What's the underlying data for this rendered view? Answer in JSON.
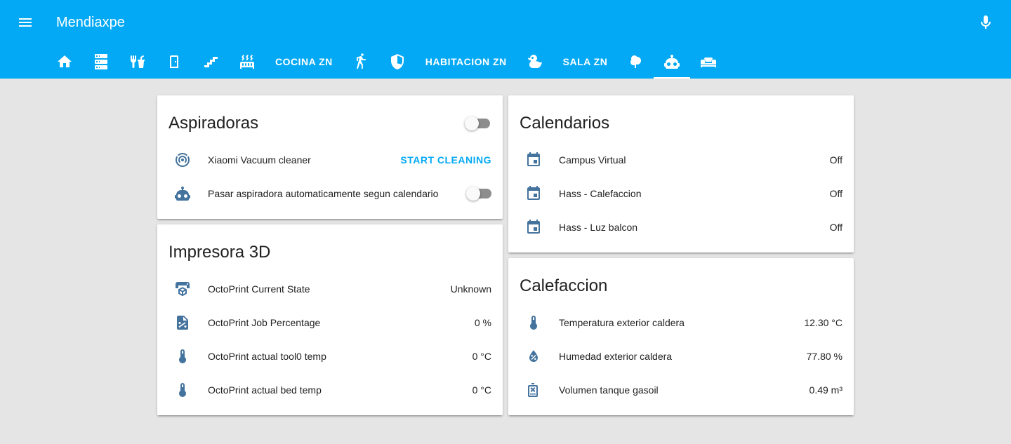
{
  "header": {
    "title": "Mendiaxpe",
    "tabs": [
      {
        "type": "icon",
        "icon": "home-icon"
      },
      {
        "type": "icon",
        "icon": "server-icon"
      },
      {
        "type": "icon",
        "icon": "silverware-icon"
      },
      {
        "type": "icon",
        "icon": "door-icon"
      },
      {
        "type": "icon",
        "icon": "stairs-icon"
      },
      {
        "type": "icon",
        "icon": "radiator-icon"
      },
      {
        "type": "text",
        "label": "COCINA ZN"
      },
      {
        "type": "icon",
        "icon": "walk-icon"
      },
      {
        "type": "icon",
        "icon": "shield-icon"
      },
      {
        "type": "text",
        "label": "HABITACION ZN"
      },
      {
        "type": "icon",
        "icon": "duck-icon"
      },
      {
        "type": "text",
        "label": "SALA ZN"
      },
      {
        "type": "icon",
        "icon": "tree-icon"
      },
      {
        "type": "icon",
        "icon": "robot-icon",
        "active": true
      },
      {
        "type": "icon",
        "icon": "sofa-icon"
      }
    ]
  },
  "aspiradoras": {
    "title": "Aspiradoras",
    "header_toggle": "off",
    "vacuum_label": "Xiaomi Vacuum cleaner",
    "vacuum_action": "START CLEANING",
    "auto_label": "Pasar aspiradora automaticamente segun calendario",
    "auto_toggle": "off"
  },
  "impresora": {
    "title": "Impresora 3D",
    "rows": [
      {
        "label": "OctoPrint Current State",
        "value": "Unknown",
        "icon": "printer-3d-icon"
      },
      {
        "label": "OctoPrint Job Percentage",
        "value": "0 %",
        "icon": "file-percent-icon"
      },
      {
        "label": "OctoPrint actual tool0 temp",
        "value": "0 °C",
        "icon": "thermometer-icon"
      },
      {
        "label": "OctoPrint actual bed temp",
        "value": "0 °C",
        "icon": "thermometer-icon"
      }
    ]
  },
  "calendarios": {
    "title": "Calendarios",
    "rows": [
      {
        "label": "Campus Virtual",
        "value": "Off",
        "icon": "calendar-icon"
      },
      {
        "label": "Hass - Calefaccion",
        "value": "Off",
        "icon": "calendar-icon"
      },
      {
        "label": "Hass - Luz balcon",
        "value": "Off",
        "icon": "calendar-icon"
      }
    ]
  },
  "calefaccion": {
    "title": "Calefaccion",
    "rows": [
      {
        "label": "Temperatura exterior caldera",
        "value": "12.30 °C",
        "icon": "thermometer-icon"
      },
      {
        "label": "Humedad exterior caldera",
        "value": "77.80 %",
        "icon": "water-percent-icon"
      },
      {
        "label": "Volumen tanque gasoil",
        "value": "0.49 m³",
        "icon": "gas-tank-icon"
      }
    ]
  },
  "colors": {
    "header": "#03a9f4",
    "icon": "#44739e",
    "accent": "#03a9f4",
    "background": "#e5e5e5"
  }
}
